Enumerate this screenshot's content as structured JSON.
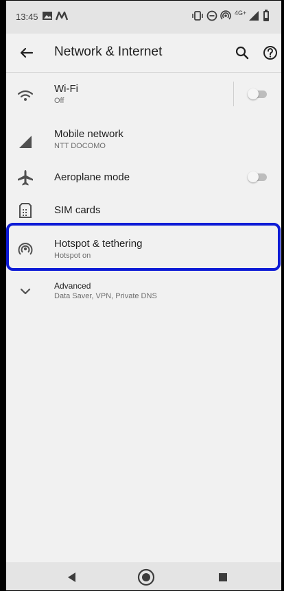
{
  "status_bar": {
    "time": "13:45",
    "network_label": "4G+",
    "icons": [
      "image-icon",
      "notification-m-icon",
      "vibrate-icon",
      "do-not-disturb-icon",
      "hotspot-icon",
      "signal-icon",
      "battery-icon"
    ]
  },
  "app_bar": {
    "title": "Network & Internet",
    "back_icon": "back-arrow-icon",
    "search_icon": "search-icon",
    "help_icon": "help-icon"
  },
  "settings": [
    {
      "label": "Wi-Fi",
      "sub": "Off",
      "icon": "wifi-icon",
      "toggle": false
    },
    {
      "label": "Mobile network",
      "sub": "NTT DOCOMO",
      "icon": "signal-icon"
    },
    {
      "label": "Aeroplane mode",
      "icon": "airplane-icon",
      "toggle": false
    },
    {
      "label": "SIM cards",
      "icon": "sim-card-icon"
    },
    {
      "label": "Hotspot & tethering",
      "sub": "Hotspot on",
      "icon": "hotspot-icon",
      "highlighted": true
    },
    {
      "label": "Advanced",
      "sub": "Data Saver, VPN, Private DNS",
      "icon": "chevron-down-icon"
    }
  ],
  "nav_bar": {
    "icons": [
      "back-triangle-icon",
      "home-circle-icon",
      "recents-square-icon"
    ]
  },
  "colors": {
    "highlight": "#0d1bd6",
    "background": "#f1f1f1",
    "bars": "#e4e4e4"
  }
}
